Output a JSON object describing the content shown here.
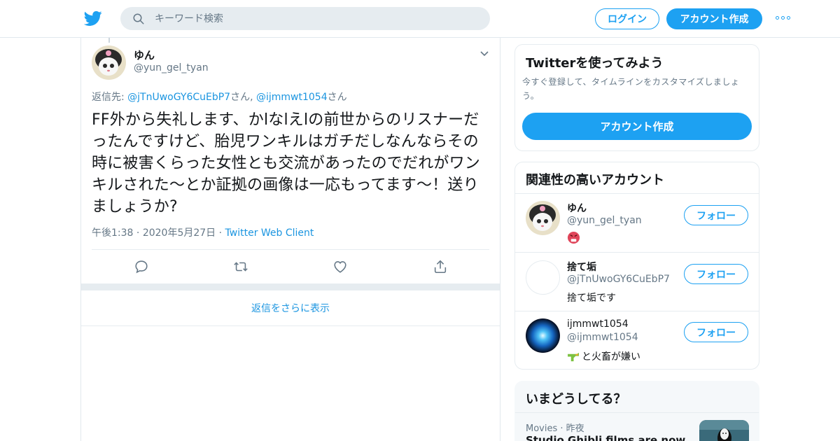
{
  "header": {
    "search_placeholder": "キーワード検索",
    "login_label": "ログイン",
    "signup_label": "アカウント作成",
    "more_icon": "more-dots-icon",
    "brand_color": "#1da1f2"
  },
  "tweet": {
    "name": "ゆん",
    "handle": "@yun_gel_tyan",
    "reply_prefix": "返信先: ",
    "reply_user1": "@jTnUwoGY6CuEbP7",
    "reply_mid": "さん, ",
    "reply_user2": "@ijmmwt1054",
    "reply_suffix": "さん",
    "text": "FF外から失礼します、かlなlえlの前世からのリスナーだったんですけど、胎児ワンキルはガチだしなんならその時に被害くらった女性とも交流があったのでだれがワンキルされた～とか証拠の画像は一応もってます～！送りましょうか?",
    "time": "午後1:38",
    "sep1": " · ",
    "date": "2020年5月27日",
    "sep2": " · ",
    "client": "Twitter Web Client",
    "more_replies": "返信をさらに表示"
  },
  "signup_card": {
    "title": "Twitterを使ってみよう",
    "description": "今すぐ登録して、タイムラインをカスタマイズしましょう。",
    "button": "アカウント作成"
  },
  "related": {
    "title": "関連性の高いアカウント",
    "follow_label": "フォロー",
    "accounts": [
      {
        "name": "ゆん",
        "handle": "@yun_gel_tyan",
        "bio": ""
      },
      {
        "name": "捨て垢",
        "handle": "@jTnUwoGY6CuEbP7",
        "bio": "捨て垢です"
      },
      {
        "name": "ijmmwt1054",
        "handle": "@ijmmwt1054",
        "bio": "と火畜が嫌い"
      }
    ]
  },
  "trends": {
    "title": "いまどうしてる？",
    "category": "Movies",
    "sep": " · ",
    "time": "昨夜",
    "headline": "Studio Ghibli films are now"
  }
}
